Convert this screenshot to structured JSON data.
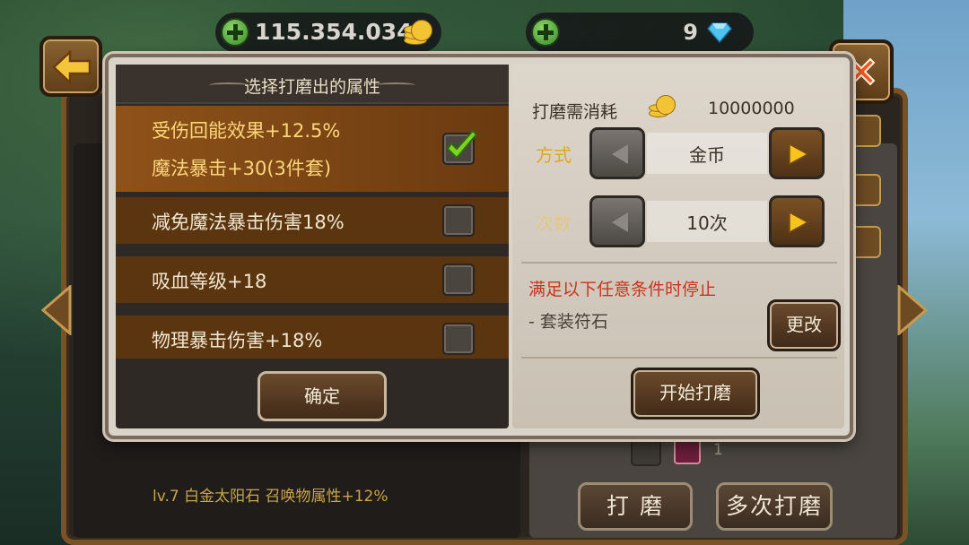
{
  "header": {
    "gold_amount": "115.354.034",
    "gem_amount": "9"
  },
  "dialog": {
    "left_title": "选择打磨出的属性",
    "options": [
      {
        "lines": [
          "受伤回能效果+12.5%",
          "魔法暴击+30(3件套)"
        ],
        "checked": true
      },
      {
        "lines": [
          "减免魔法暴击伤害18%"
        ],
        "checked": false
      },
      {
        "lines": [
          "吸血等级+18"
        ],
        "checked": false
      },
      {
        "lines": [
          "物理暴击伤害+18%"
        ],
        "checked": false
      }
    ],
    "confirm_label": "确定",
    "cost_label": "打磨需消耗",
    "cost_value": "10000000",
    "mode_label": "方式",
    "mode_value": "金币",
    "count_label": "次数",
    "count_value": "10次",
    "stop_title": "满足以下任意条件时停止",
    "stop_item": "-  套装符石",
    "change_label": "更改",
    "start_label": "开始打磨"
  },
  "background": {
    "footer_text": "lv.7  白金太阳石  召唤物属性+12%",
    "count_number": "1",
    "polish_label": "打 磨",
    "multi_polish_label": "多次打磨"
  }
}
